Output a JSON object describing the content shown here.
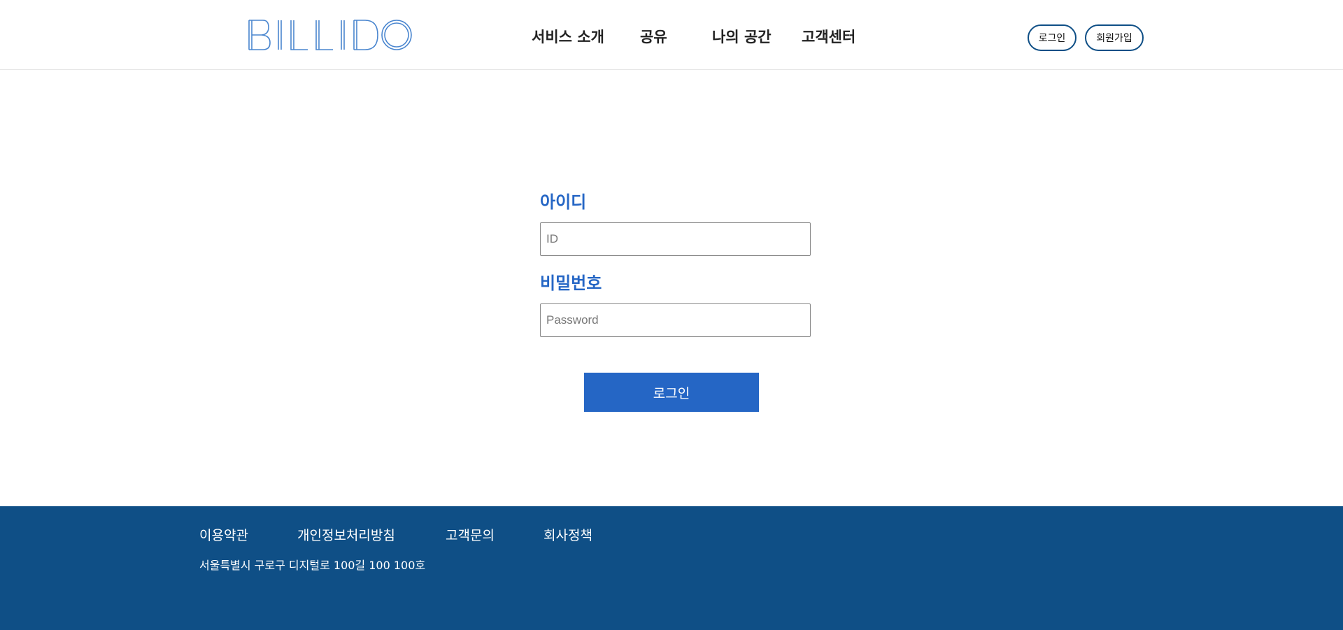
{
  "header": {
    "logo_text": "BILLIDO",
    "nav": [
      {
        "label": "서비스 소개"
      },
      {
        "label": "공유"
      },
      {
        "label": "나의 공간"
      },
      {
        "label": "고객센터"
      }
    ],
    "login_label": "로그인",
    "signup_label": "회원가입"
  },
  "login_form": {
    "id_label": "아이디",
    "id_placeholder": "ID",
    "id_value": "",
    "password_label": "비밀번호",
    "password_placeholder": "Password",
    "password_value": "",
    "submit_label": "로그인"
  },
  "footer": {
    "links": [
      {
        "label": "이용약관"
      },
      {
        "label": "개인정보처리방침"
      },
      {
        "label": "고객문의"
      },
      {
        "label": "회사정책"
      }
    ],
    "address": "서울특별시 구로구 디지털로 100길 100 100호"
  },
  "colors": {
    "accent": "#2566c5",
    "footer_bg": "#0f4f86",
    "logo": "#4a86cf"
  }
}
